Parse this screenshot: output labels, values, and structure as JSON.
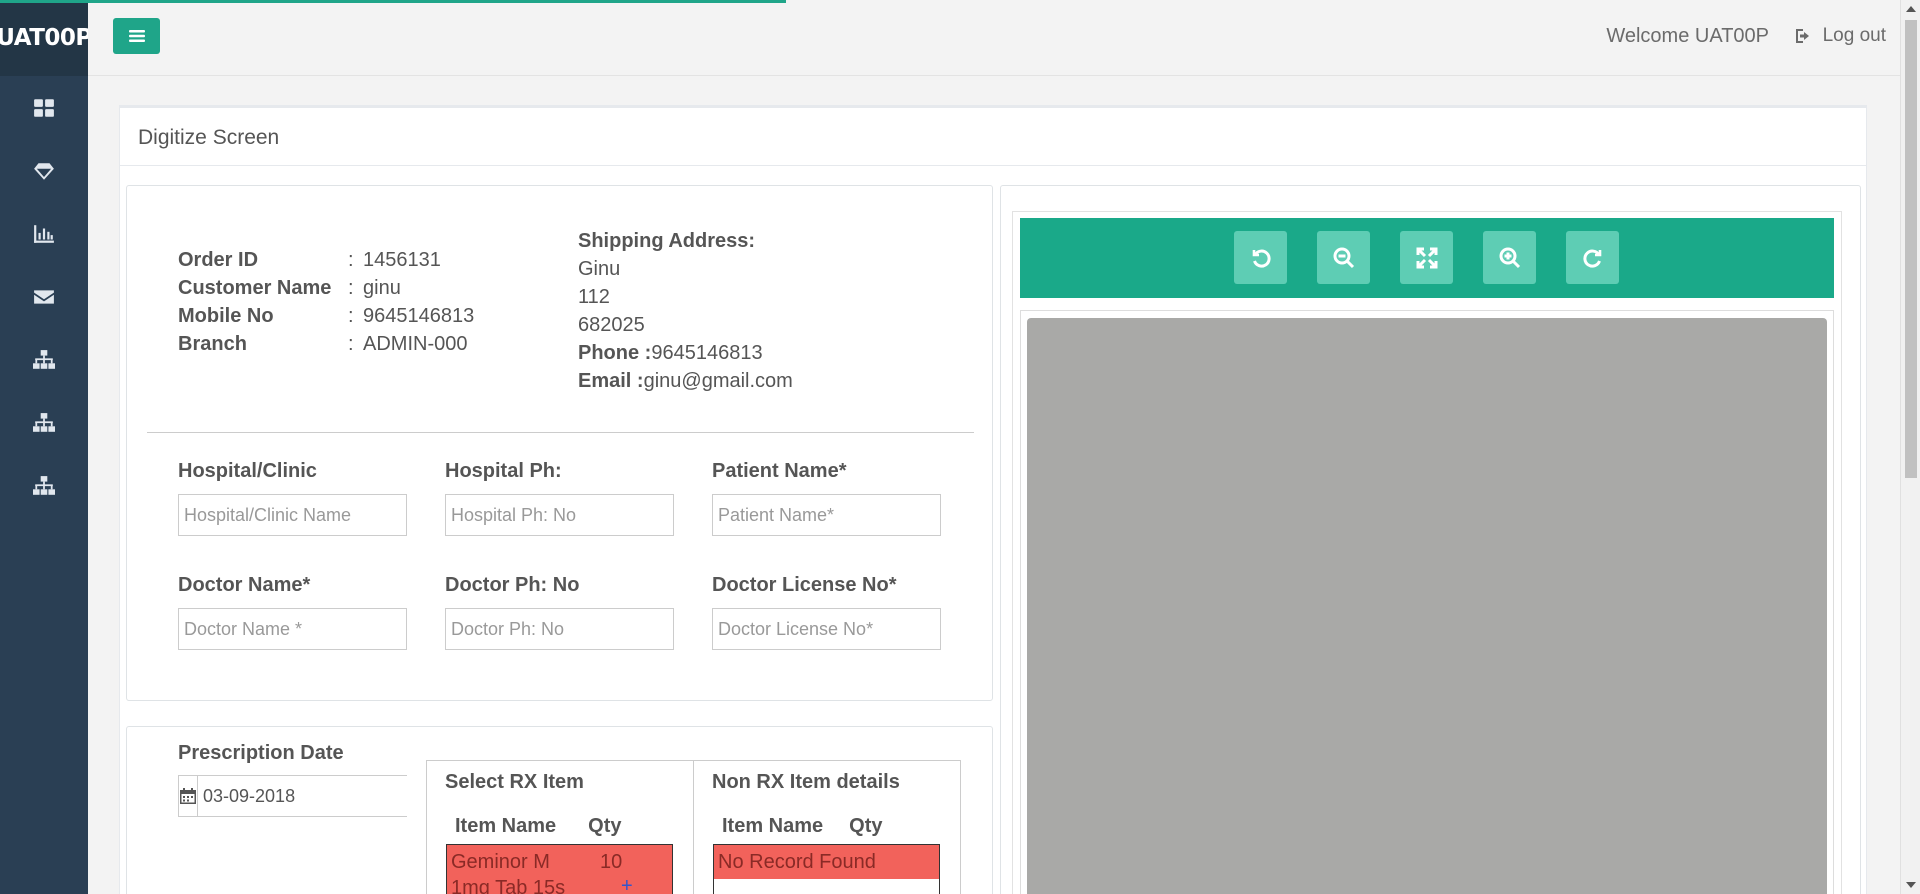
{
  "app": {
    "brand": "UAT00P"
  },
  "topbar": {
    "welcome": "Welcome UAT00P",
    "logout": "Log out"
  },
  "sidebar": {
    "icons": [
      "dashboard-icon",
      "diamond-icon",
      "bar-chart-icon",
      "envelope-icon",
      "sitemap-icon",
      "sitemap-icon",
      "sitemap-icon"
    ]
  },
  "page": {
    "title": "Digitize Screen"
  },
  "order": {
    "order_id_label": "Order ID",
    "order_id": "1456131",
    "customer_label": "Customer Name",
    "customer": "ginu",
    "mobile_label": "Mobile No",
    "mobile": "9645146813",
    "branch_label": "Branch",
    "branch": "ADMIN-000",
    "colon": ":"
  },
  "shipping": {
    "title": "Shipping Address:",
    "line1": "Ginu",
    "line2": "112",
    "line3": "682025",
    "phone_label": "Phone :",
    "phone": "9645146813",
    "email_label": "Email :",
    "email": "ginu@gmail.com"
  },
  "form": {
    "hospital_label": "Hospital/Clinic",
    "hospital_placeholder": "Hospital/Clinic Name",
    "hospital_ph_label": "Hospital Ph:",
    "hospital_ph_placeholder": "Hospital Ph: No",
    "patient_label": "Patient Name*",
    "patient_placeholder": "Patient Name*",
    "doctor_label": "Doctor Name*",
    "doctor_placeholder": "Doctor Name *",
    "doctor_ph_label": "Doctor Ph: No",
    "doctor_ph_placeholder": "Doctor Ph: No",
    "license_label": "Doctor License No*",
    "license_placeholder": "Doctor License No*"
  },
  "prescription": {
    "date_label": "Prescription Date",
    "date_value": "03-09-2018",
    "rx_title": "Select RX Item",
    "non_rx_title": "Non RX Item details",
    "col_item": "Item Name",
    "col_qty": "Qty",
    "rx_item_line1": "Geminor M",
    "rx_item_line2": "1mg Tab 15s",
    "rx_qty": "10",
    "rx_add": "+",
    "non_rx_empty": "No Record Found"
  },
  "viewer": {
    "tools": [
      "rotate-left-icon",
      "zoom-out-icon",
      "fit-screen-icon",
      "zoom-in-icon",
      "rotate-right-icon"
    ]
  }
}
